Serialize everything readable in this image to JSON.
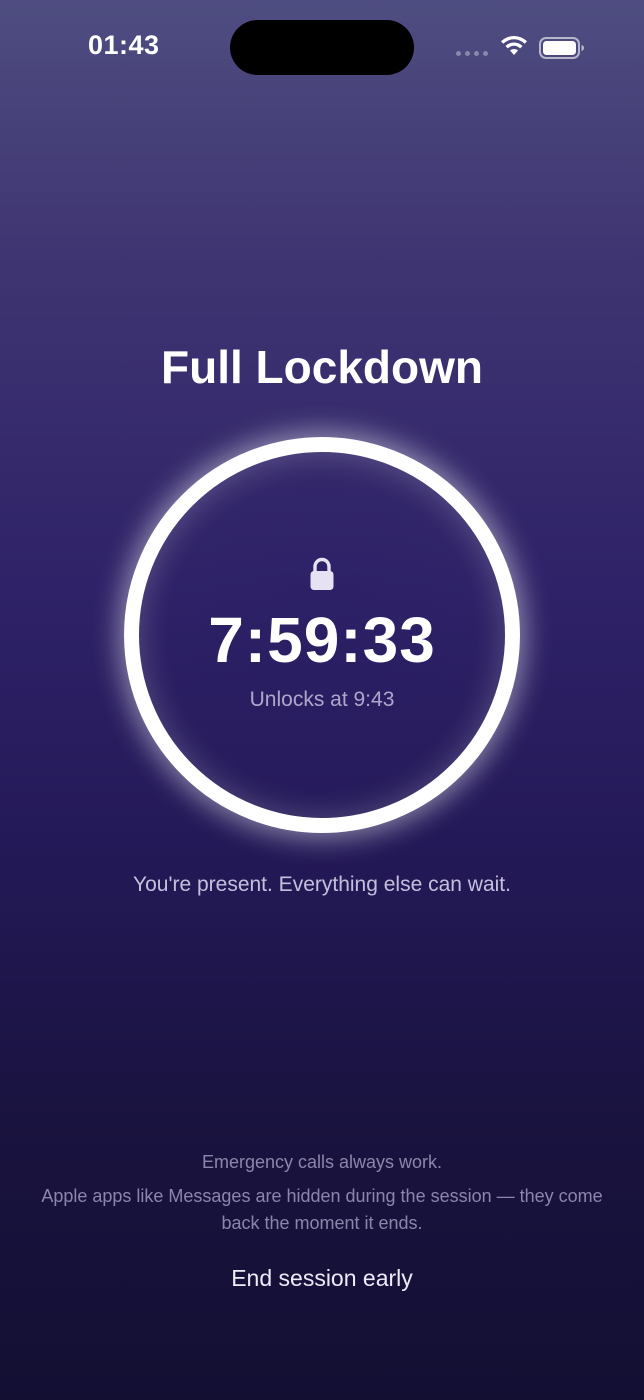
{
  "status_bar": {
    "time": "01:43",
    "icons": [
      "signal-icon",
      "wifi-icon",
      "battery-icon"
    ]
  },
  "session": {
    "title": "Full Lockdown",
    "lock_icon": "lock-icon",
    "countdown": "7:59:33",
    "unlocks_at": "Unlocks at 9:43",
    "ring_progress": 1.0
  },
  "tagline": "You're present. Everything else can wait.",
  "footer": {
    "emergency_note": "Emergency calls always work.",
    "apps_note": "Apple apps like Messages are hidden during the session — they come back the moment it ends.",
    "end_session_label": "End session early"
  },
  "colors": {
    "background_top": "#4e4d80",
    "background_mid": "#2f2268",
    "background_bottom": "#130f33",
    "ring": "#ffffff"
  }
}
